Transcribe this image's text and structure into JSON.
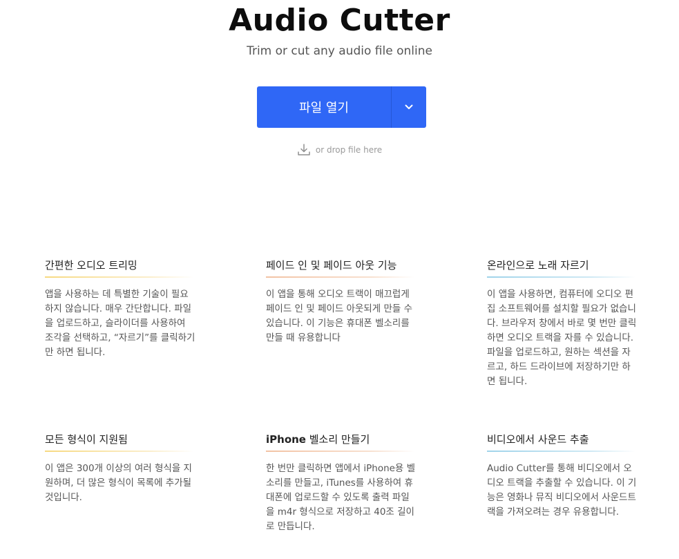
{
  "header": {
    "title": "Audio Cutter",
    "subtitle": "Trim or cut any audio file online"
  },
  "open_button": {
    "label": "파일 열기",
    "dropdown_icon": "chevron-down-icon",
    "color": "#2f67f6"
  },
  "drop_hint": {
    "text": "or drop file here",
    "icon": "download-icon"
  },
  "features": [
    {
      "title": "간편한 오디오 트리밍",
      "text": "앱을 사용하는 데 특별한 기술이 필요하지 않습니다. 매우 간단합니다. 파일을 업로드하고, 슬라이더를 사용하여 조각을 선택하고, “자르기”를 클릭하기만 하면 됩니다."
    },
    {
      "title": "페이드 인 및 페이드 아웃 기능",
      "text": "이 앱을 통해 오디오 트랙이 매끄럽게 페이드 인 및 페이드 아웃되게 만들 수 있습니다. 이 기능은 휴대폰 벨소리를 만들 때 유용합니다"
    },
    {
      "title": "온라인으로 노래 자르기",
      "text": "이 앱을 사용하면, 컴퓨터에 오디오 편집 소프트웨어를 설치할 필요가 없습니다. 브라우저 창에서 바로 몇 번만 클릭하면 오디오 트랙을 자를 수 있습니다. 파일을 업로드하고, 원하는 섹션을 자르고, 하드 드라이브에 저장하기만 하면 됩니다."
    },
    {
      "title": "모든 형식이 지원됨",
      "text": "이 앱은 300개 이상의 여러 형식을 지원하며, 더 많은 형식이 목록에 추가될 것입니다."
    },
    {
      "title_bold": "iPhone",
      "title": " 벨소리 만들기",
      "text": "한 번만 클릭하면 앱에서 iPhone용 벨소리를 만들고, iTunes를 사용하여 휴대폰에 업로드할 수 있도록 출력 파일을 m4r 형식으로 저장하고 40조 길이로 만듭니다."
    },
    {
      "title": "비디오에서 사운드 추출",
      "text": "Audio Cutter를 통해 비디오에서 오디오 트랙을 추출할 수 있습니다. 이 기능은 영화나 뮤직 비디오에서 사운드트랙을 가져오려는 경우 유용합니다."
    }
  ]
}
